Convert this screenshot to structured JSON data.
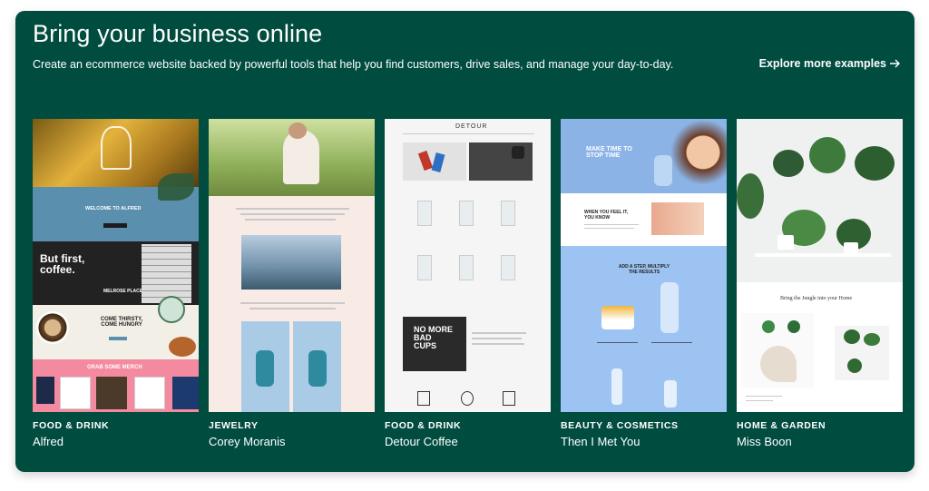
{
  "header": {
    "title": "Bring your business online",
    "subtitle": "Create an ecommerce website backed by powerful tools that help you find customers, drive sales, and manage your day-to-day.",
    "explore_label": "Explore more examples"
  },
  "colors": {
    "panel": "#004c3f",
    "text": "#ffffff"
  },
  "examples": [
    {
      "category": "FOOD & DRINK",
      "name": "Alfred",
      "screenshot_text": [
        "WELCOME TO ALFRED",
        "But first, coffee.",
        "MELROSE PLACE",
        "COME THIRSTY, COME HUNGRY",
        "GRAB SOME MERCH"
      ]
    },
    {
      "category": "JEWELRY",
      "name": "Corey Moranis",
      "screenshot_text": []
    },
    {
      "category": "FOOD & DRINK",
      "name": "Detour Coffee",
      "screenshot_text": [
        "DETOUR",
        "NO MORE BAD CUPS"
      ]
    },
    {
      "category": "BEAUTY & COSMETICS",
      "name": "Then I Met You",
      "screenshot_text": [
        "MAKE TIME TO STOP TIME",
        "WHEN YOU FEEL IT, YOU KNOW",
        "ADD A STEP, MULTIPLY THE RESULTS"
      ]
    },
    {
      "category": "HOME & GARDEN",
      "name": "Miss Boon",
      "screenshot_text": [
        "Bring the Jungle into your Home"
      ]
    }
  ]
}
